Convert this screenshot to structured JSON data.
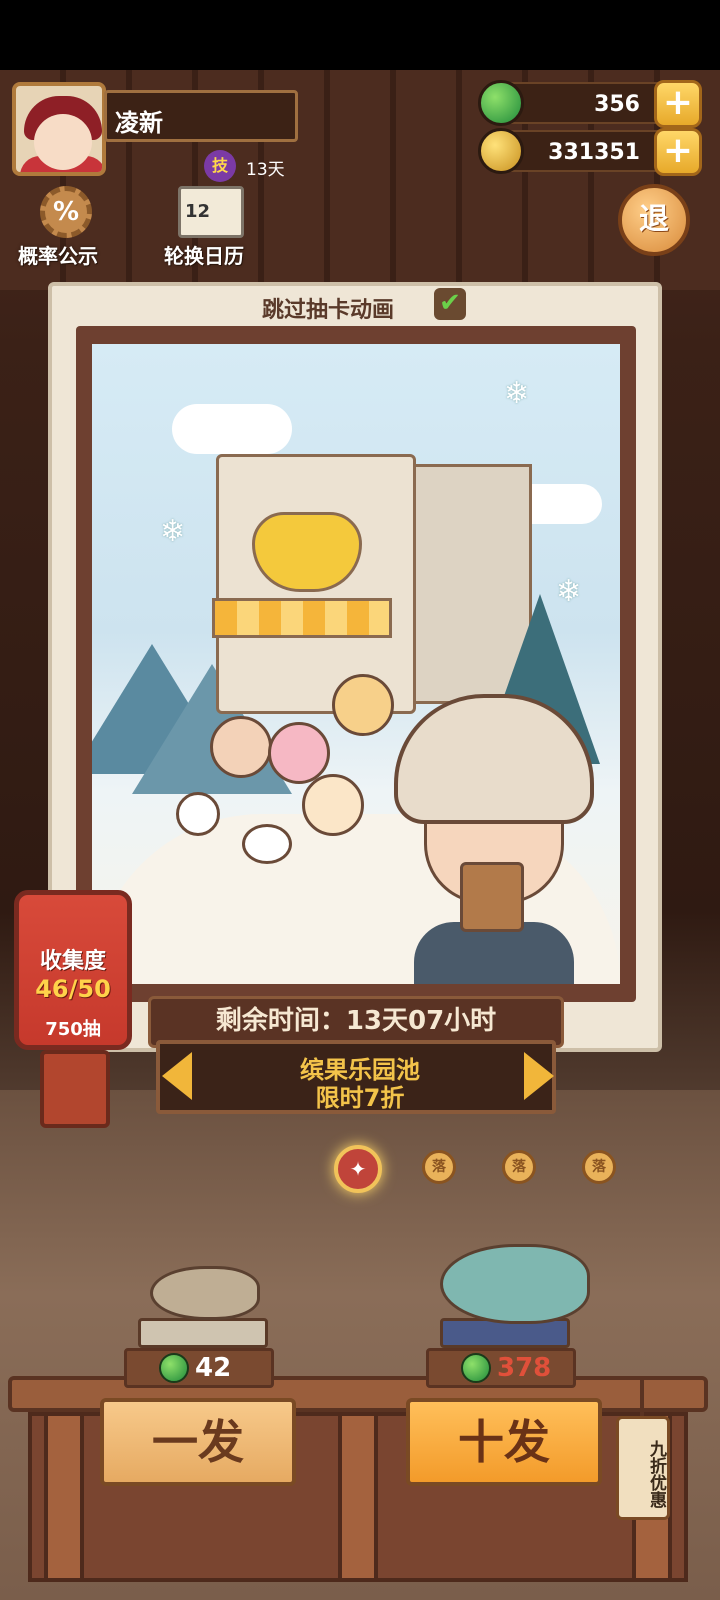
{
  "player": {
    "name": "凌新",
    "skill_badge": "技",
    "days": "13天"
  },
  "currency": {
    "jade": "356",
    "coins": "331351",
    "plus_symbol": "+"
  },
  "top_buttons": {
    "probability_icon": "%",
    "probability_label": "概率公示",
    "calendar_icon_text": "12",
    "calendar_label": "轮换日历",
    "exit_label": "退"
  },
  "card": {
    "skip_animation_label": "跳过抽卡动画",
    "skip_checked": true,
    "check_mark": "✔"
  },
  "pool": {
    "remaining_time": "剩余时间：13天07小时",
    "name": "缤果乐园池",
    "discount": "限时7折"
  },
  "collection": {
    "title": "收集度",
    "progress": "46/50",
    "pulls": "750抽"
  },
  "pages": {
    "active_icon": "✦",
    "dots": [
      "落",
      "落",
      "落"
    ]
  },
  "draw": {
    "single_cost": "42",
    "ten_cost": "378",
    "single_label": "一发",
    "ten_label": "十发",
    "discount_tag": "九折优惠",
    "colors": {
      "single_cost": "#ffffff",
      "ten_cost": "#e0503a"
    }
  }
}
